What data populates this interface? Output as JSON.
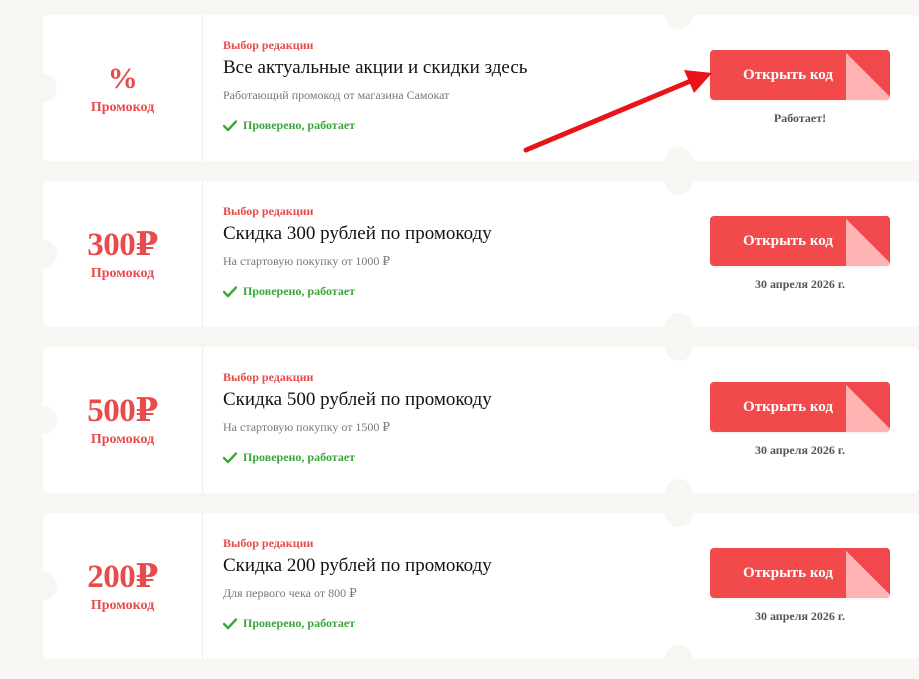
{
  "accent_color": "#e84b4b",
  "button_color": "#f24a4a",
  "verified_color": "#3aa63a",
  "offers": [
    {
      "value": "%",
      "value_label": "Промокод",
      "badge": "Выбор редакции",
      "title": "Все актуальные акции и скидки здесь",
      "description": "Работающий промокод от магазина Самокат",
      "verified": "Проверено, работает",
      "button": "Открыть код",
      "sub": "Работает!"
    },
    {
      "value": "300₽",
      "value_label": "Промокод",
      "badge": "Выбор редакции",
      "title": "Скидка 300 рублей по промокоду",
      "description": "На стартовую покупку от 1000 ₽",
      "verified": "Проверено, работает",
      "button": "Открыть код",
      "sub": "30 апреля 2026 г."
    },
    {
      "value": "500₽",
      "value_label": "Промокод",
      "badge": "Выбор редакции",
      "title": "Скидка 500 рублей по промокоду",
      "description": "На стартовую покупку от 1500 ₽",
      "verified": "Проверено, работает",
      "button": "Открыть код",
      "sub": "30 апреля 2026 г."
    },
    {
      "value": "200₽",
      "value_label": "Промокод",
      "badge": "Выбор редакции",
      "title": "Скидка 200 рублей по промокоду",
      "description": "Для первого чека от 800 ₽",
      "verified": "Проверено, работает",
      "button": "Открыть код",
      "sub": "30 апреля 2026 г."
    }
  ],
  "annotation": {
    "arrow_icon": "red-arrow-icon",
    "arrow_color": "#e8141a"
  }
}
